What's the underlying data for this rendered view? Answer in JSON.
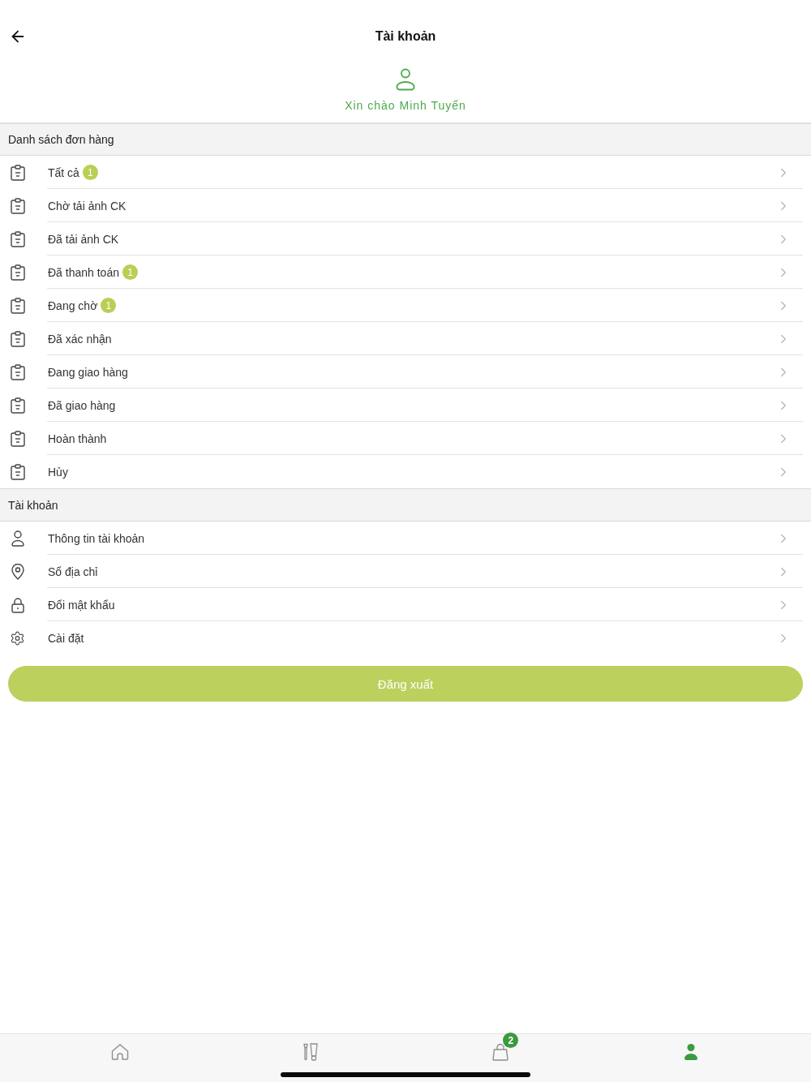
{
  "header": {
    "title": "Tài khoản",
    "greeting": "Xin chào Minh Tuyến"
  },
  "sections": [
    {
      "title": "Danh sách đơn hàng",
      "items": [
        {
          "kind": "order",
          "label": "Tất cả",
          "badge": "1"
        },
        {
          "kind": "order",
          "label": "Chờ tải ảnh CK"
        },
        {
          "kind": "order",
          "label": "Đã tải ảnh CK"
        },
        {
          "kind": "order",
          "label": "Đã thanh toán",
          "badge": "1"
        },
        {
          "kind": "order",
          "label": "Đang chờ",
          "badge": "1"
        },
        {
          "kind": "order",
          "label": "Đã xác nhận"
        },
        {
          "kind": "order",
          "label": "Đang giao hàng"
        },
        {
          "kind": "order",
          "label": "Đã giao hàng"
        },
        {
          "kind": "order",
          "label": "Hoàn thành"
        },
        {
          "kind": "order",
          "label": "Hủy"
        }
      ]
    },
    {
      "title": "Tài khoản",
      "items": [
        {
          "kind": "person",
          "label": "Thông tin tài khoản"
        },
        {
          "kind": "pin",
          "label": "Sổ địa chỉ"
        },
        {
          "kind": "lock",
          "label": "Đổi mật khẩu"
        },
        {
          "kind": "gear",
          "label": "Cài đặt"
        }
      ]
    }
  ],
  "logout_button": {
    "label": "Đăng xuất"
  },
  "tab_bar": [
    {
      "kind": "home",
      "selected": false
    },
    {
      "kind": "cosmetics",
      "selected": false
    },
    {
      "kind": "bag",
      "selected": false,
      "badge": "2"
    },
    {
      "kind": "person",
      "selected": true
    }
  ]
}
